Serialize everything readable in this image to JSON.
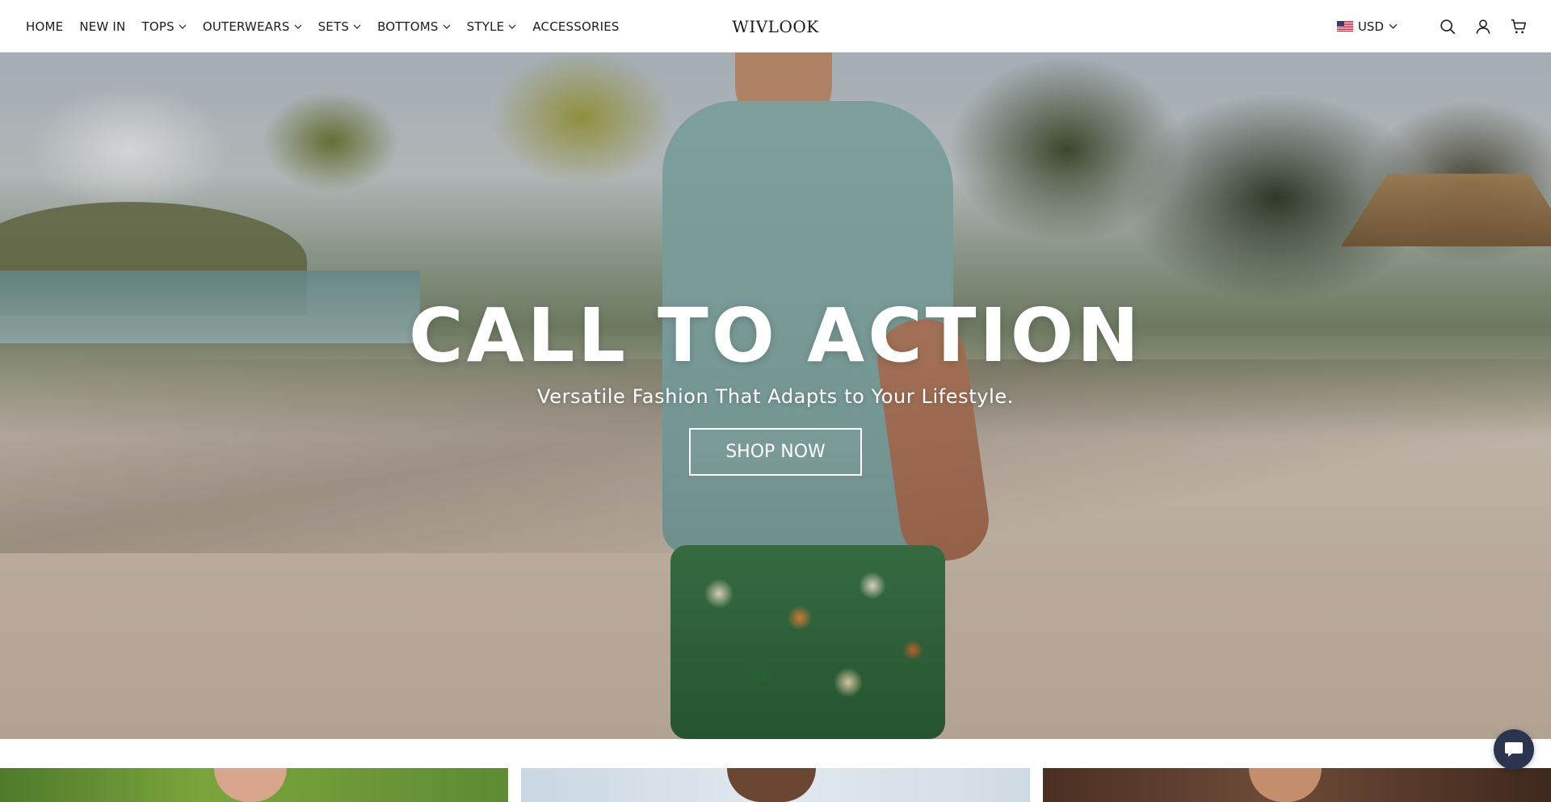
{
  "header": {
    "brand": "WIVLOOK",
    "nav": [
      {
        "label": "HOME",
        "has_dropdown": false
      },
      {
        "label": "NEW IN",
        "has_dropdown": false
      },
      {
        "label": "TOPS",
        "has_dropdown": true
      },
      {
        "label": "OUTERWEARS",
        "has_dropdown": true
      },
      {
        "label": "SETS",
        "has_dropdown": true
      },
      {
        "label": "BOTTOMS",
        "has_dropdown": true
      },
      {
        "label": "STYLE",
        "has_dropdown": true
      },
      {
        "label": "ACCESSORIES",
        "has_dropdown": false
      }
    ],
    "currency": {
      "label": "USD",
      "flag": "us-flag-icon"
    },
    "icons": [
      "search-icon",
      "account-icon",
      "cart-icon"
    ]
  },
  "hero": {
    "title": "CALL TO ACTION",
    "subtitle": "Versatile Fashion That Adapts to Your Lifestyle.",
    "button_label": "SHOP NOW"
  },
  "chat": {
    "icon": "chat-icon",
    "color": "#2b3550"
  }
}
